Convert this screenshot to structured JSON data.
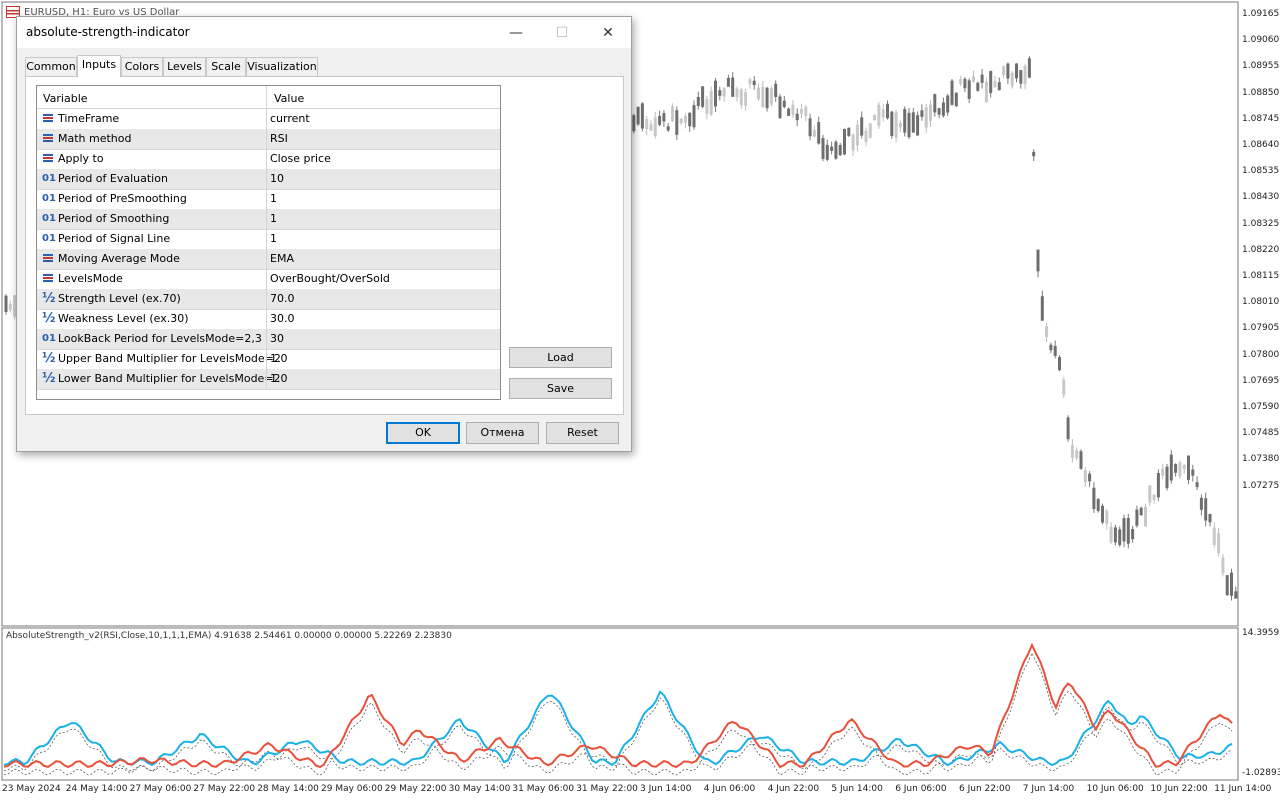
{
  "background_window": {
    "title": "EURUSD, H1: Euro vs US Dollar"
  },
  "chart": {
    "price_labels": [
      "1.09165",
      "1.09060",
      "1.08955",
      "1.08850",
      "1.08745",
      "1.08640",
      "1.08535",
      "1.08430",
      "1.08325",
      "1.08220",
      "1.08115",
      "1.08010",
      "1.07905",
      "1.07800",
      "1.07695",
      "1.07590",
      "1.07485",
      "1.07380",
      "1.07275"
    ],
    "indicator_labels": [
      "14.39592",
      "-1.02893"
    ],
    "time_labels": [
      "23 May 2024",
      "24 May 14:00",
      "27 May 06:00",
      "27 May 22:00",
      "28 May 14:00",
      "29 May 06:00",
      "29 May 22:00",
      "30 May 14:00",
      "31 May 06:00",
      "31 May 22:00",
      "3 Jun 14:00",
      "4 Jun 06:00",
      "4 Jun 22:00",
      "5 Jun 14:00",
      "6 Jun 06:00",
      "6 Jun 22:00",
      "7 Jun 14:00",
      "10 Jun 06:00",
      "10 Jun 22:00",
      "11 Jun 14:00"
    ],
    "indicator_caption": "AbsoluteStrength_v2(RSI,Close,10,1,1,1,EMA) 4.91638 2.54461 0.00000 0.00000 5.22269 2.23830",
    "colors": {
      "bull_line": "#1ab0e8",
      "bear_line": "#e8503a",
      "candle": "#999999",
      "dotted": "#444444"
    }
  },
  "dialog": {
    "title": "absolute-strength-indicator",
    "tabs": [
      "Common",
      "Inputs",
      "Colors",
      "Levels",
      "Scale",
      "Visualization"
    ],
    "active_tab": "Inputs",
    "columns": {
      "variable": "Variable",
      "value": "Value"
    },
    "rows": [
      {
        "icon": "enum-icon",
        "variable": "TimeFrame",
        "value": "current"
      },
      {
        "icon": "enum-icon",
        "variable": "Math method",
        "value": "RSI"
      },
      {
        "icon": "enum-icon",
        "variable": "Apply to",
        "value": "Close price"
      },
      {
        "icon": "int-icon",
        "variable": "Period of Evaluation",
        "value": "10"
      },
      {
        "icon": "int-icon",
        "variable": "Period of PreSmoothing",
        "value": "1"
      },
      {
        "icon": "int-icon",
        "variable": "Period of Smoothing",
        "value": "1"
      },
      {
        "icon": "int-icon",
        "variable": "Period of Signal Line",
        "value": "1"
      },
      {
        "icon": "enum-icon",
        "variable": "Moving Average Mode",
        "value": "EMA"
      },
      {
        "icon": "enum-icon",
        "variable": "LevelsMode",
        "value": "OverBought/OverSold"
      },
      {
        "icon": "double-icon",
        "variable": "Strength Level (ex.70)",
        "value": "70.0"
      },
      {
        "icon": "double-icon",
        "variable": "Weakness Level (ex.30)",
        "value": "30.0"
      },
      {
        "icon": "int-icon",
        "variable": "LookBack Period for LevelsMode=2,3",
        "value": "30"
      },
      {
        "icon": "double-icon",
        "variable": "Upper Band Multiplier for LevelsMode=2",
        "value": "1.0"
      },
      {
        "icon": "double-icon",
        "variable": "Lower Band Multiplier for LevelsMode=2",
        "value": "1.0"
      }
    ],
    "icon_glyphs": {
      "int": "01",
      "double": "½"
    },
    "buttons": {
      "load": "Load",
      "save": "Save",
      "ok": "OK",
      "cancel": "Отмена",
      "reset": "Reset"
    },
    "window_controls": {
      "minimize": "—",
      "maximize": "☐",
      "close": "✕"
    }
  }
}
